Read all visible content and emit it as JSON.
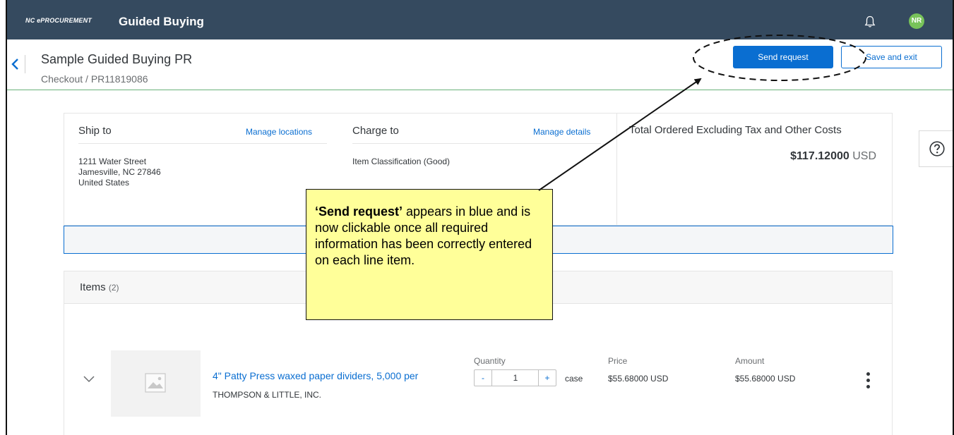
{
  "topbar": {
    "brand": "NC ePROCUREMENT",
    "app_title": "Guided Buying",
    "avatar_initials": "NR"
  },
  "header": {
    "title": "Sample Guided Buying PR",
    "breadcrumb": "Checkout  /  PR11819086",
    "send_label": "Send request",
    "save_label": "Save and exit"
  },
  "summary": {
    "ship_to": {
      "title": "Ship to",
      "link": "Manage locations",
      "line1": "1211 Water Street",
      "line2": "Jamesville, NC  27846",
      "line3": "United States"
    },
    "charge_to": {
      "title": "Charge to",
      "link": "Manage details",
      "value": "Item Classification (Good)"
    },
    "total": {
      "label": "Total Ordered Excluding Tax and Other Costs",
      "amount": "$117.12000",
      "currency": "USD"
    }
  },
  "items": {
    "title": "Items",
    "count": "(2)",
    "rows": [
      {
        "name": "4\" Patty Press waxed paper dividers, 5,000 per",
        "vendor": "THOMPSON & LITTLE, INC.",
        "quantity_label": "Quantity",
        "minus": "-",
        "quantity": "1",
        "plus": "+",
        "unit": "case",
        "price_label": "Price",
        "price": "$55.68000 USD",
        "amount_label": "Amount",
        "amount": "$55.68000 USD"
      }
    ]
  },
  "callout": {
    "bold": "‘Send request’",
    "text": " appears in blue and is now clickable once all required information has been correctly entered on each line item."
  },
  "colors": {
    "topbar": "#354a5f",
    "primary": "#0a6ed1",
    "avatar": "#78c35a",
    "callout": "#ffff99"
  }
}
